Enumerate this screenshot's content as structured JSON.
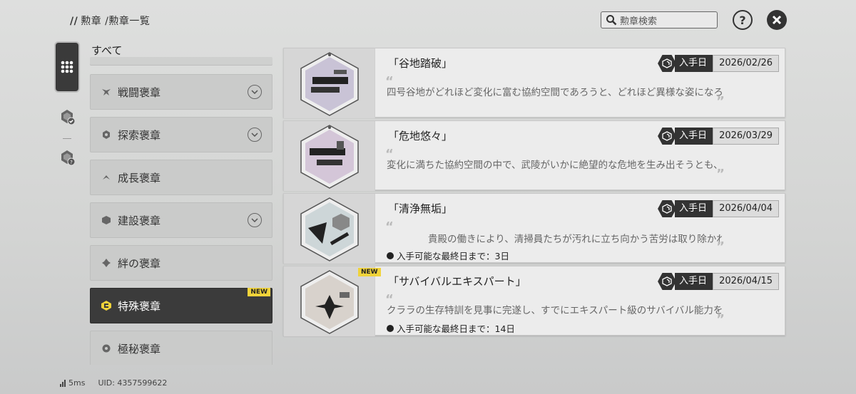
{
  "breadcrumb": {
    "prefix": "//",
    "items": "勲章 /勲章一覧"
  },
  "search": {
    "placeholder": "勲章検索"
  },
  "buttons": {
    "help": "?"
  },
  "categories": {
    "header": "すべて",
    "items": [
      {
        "label": "戦闘褒章",
        "expandable": true,
        "active": false
      },
      {
        "label": "探索褒章",
        "expandable": true,
        "active": false
      },
      {
        "label": "成長褒章",
        "expandable": false,
        "active": false
      },
      {
        "label": "建設褒章",
        "expandable": true,
        "active": false
      },
      {
        "label": "絆の褒章",
        "expandable": false,
        "active": false
      },
      {
        "label": "特殊褒章",
        "expandable": false,
        "active": true,
        "badge": "NEW"
      },
      {
        "label": "極秘褒章",
        "expandable": false,
        "active": false
      }
    ]
  },
  "medals": [
    {
      "title": "「谷地踏破」",
      "acquired_label": "入手日",
      "date": "2026/02/26",
      "desc": "四号谷地がどれほど変化に富む協約空間であろうと、どれほど異様な姿になろう",
      "deadline": ""
    },
    {
      "title": "「危地悠々」",
      "acquired_label": "入手日",
      "date": "2026/03/29",
      "desc": "変化に満ちた協約空間の中で、武陵がいかに絶望的な危地を生み出そうとも、",
      "deadline": ""
    },
    {
      "title": "「清浄無垢」",
      "acquired_label": "入手日",
      "date": "2026/04/04",
      "desc": "貴殿の働きにより、清掃員たちが汚れに立ち向かう苦労は取り除かれ",
      "deadline": "入手可能な最終日まで：3日"
    },
    {
      "title": "「サバイバルエキスパート」",
      "acquired_label": "入手日",
      "date": "2026/04/15",
      "desc": "クララの生存特訓を見事に完遂し、すでにエキスパート級のサバイバル能力を身",
      "deadline": "入手可能な最終日まで：14日",
      "badge": "NEW"
    }
  ],
  "status": {
    "ping": "5ms",
    "uid": "UID: 4357599622"
  }
}
